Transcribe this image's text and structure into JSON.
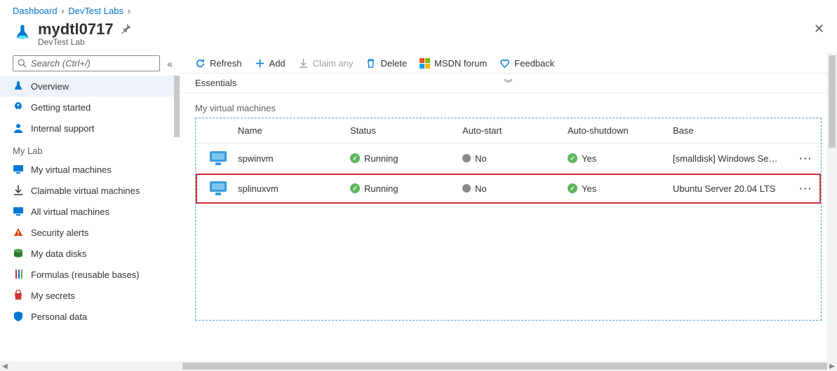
{
  "breadcrumb": {
    "items": [
      "Dashboard",
      "DevTest Labs"
    ]
  },
  "header": {
    "title": "mydtl0717",
    "subtitle": "DevTest Lab"
  },
  "search": {
    "placeholder": "Search (Ctrl+/)"
  },
  "sidebar": {
    "items": [
      {
        "id": "overview",
        "label": "Overview",
        "active": true,
        "icon": "lab"
      },
      {
        "id": "getting-started",
        "label": "Getting started",
        "icon": "rocket"
      },
      {
        "id": "internal-support",
        "label": "Internal support",
        "icon": "person"
      }
    ],
    "group_label": "My Lab",
    "lab_items": [
      {
        "id": "my-vms",
        "label": "My virtual machines",
        "icon": "vm"
      },
      {
        "id": "claimable",
        "label": "Claimable virtual machines",
        "icon": "download"
      },
      {
        "id": "all-vms",
        "label": "All virtual machines",
        "icon": "vm"
      },
      {
        "id": "security-alerts",
        "label": "Security alerts",
        "icon": "alert"
      },
      {
        "id": "my-data-disks",
        "label": "My data disks",
        "icon": "disk"
      },
      {
        "id": "formulas",
        "label": "Formulas (reusable bases)",
        "icon": "flask"
      },
      {
        "id": "my-secrets",
        "label": "My secrets",
        "icon": "bag"
      },
      {
        "id": "personal-data",
        "label": "Personal data",
        "icon": "shield"
      }
    ]
  },
  "toolbar": {
    "refresh": "Refresh",
    "add": "Add",
    "claim_any": "Claim any",
    "delete": "Delete",
    "msdn": "MSDN forum",
    "feedback": "Feedback"
  },
  "essentials_label": "Essentials",
  "vm_section_title": "My virtual machines",
  "vm_columns": {
    "name": "Name",
    "status": "Status",
    "autostart": "Auto-start",
    "autoshutdown": "Auto-shutdown",
    "base": "Base"
  },
  "vms": [
    {
      "name": "spwinvm",
      "status": "Running",
      "autostart": "No",
      "autoshutdown": "Yes",
      "base": "[smalldisk] Windows Se…",
      "highlight": false
    },
    {
      "name": "splinuxvm",
      "status": "Running",
      "autostart": "No",
      "autoshutdown": "Yes",
      "base": "Ubuntu Server 20.04 LTS",
      "highlight": true
    }
  ]
}
